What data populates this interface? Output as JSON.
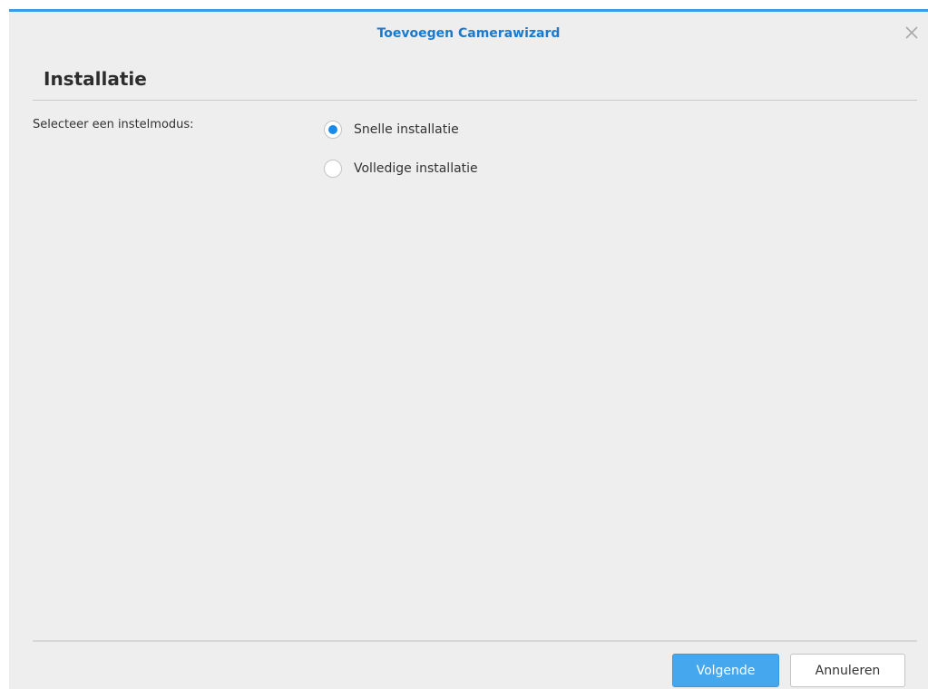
{
  "dialog": {
    "title": "Toevoegen Camerawizard",
    "close_icon": "close-icon",
    "accent_color": "#3c9be6"
  },
  "section": {
    "heading": "Installatie"
  },
  "setup_mode": {
    "label": "Selecteer een instelmodus:",
    "options": [
      {
        "label": "Snelle installatie",
        "selected": true
      },
      {
        "label": "Volledige installatie",
        "selected": false
      }
    ]
  },
  "footer": {
    "next_label": "Volgende",
    "cancel_label": "Annuleren",
    "primary_color": "#45a7ee"
  }
}
